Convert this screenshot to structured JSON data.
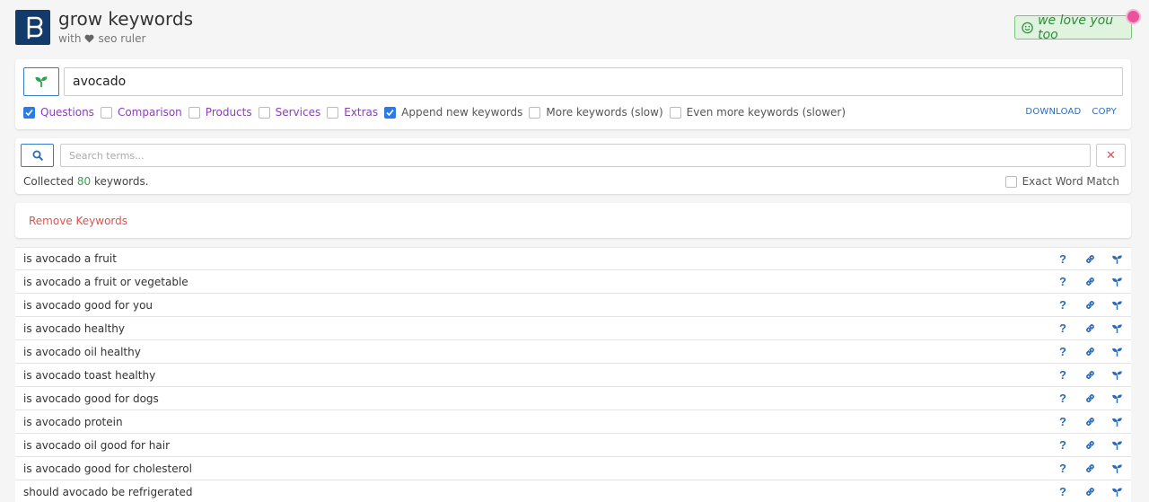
{
  "header": {
    "app_title": "grow keywords",
    "subtitle_prefix": "with",
    "subtitle_suffix": "seo ruler",
    "love_label": "we love you too"
  },
  "grow": {
    "keyword_value": "avocado",
    "options": [
      {
        "label": "Questions",
        "checked": true
      },
      {
        "label": "Comparison",
        "checked": false
      },
      {
        "label": "Products",
        "checked": false
      },
      {
        "label": "Services",
        "checked": false
      },
      {
        "label": "Extras",
        "checked": false
      },
      {
        "label": "Append new keywords",
        "checked": true
      },
      {
        "label": "More keywords (slow)",
        "checked": false
      },
      {
        "label": "Even more keywords (slower)",
        "checked": false
      }
    ],
    "download_label": "DOWNLOAD",
    "copy_label": "COPY"
  },
  "search": {
    "placeholder": "Search terms...",
    "clear_symbol": "✕",
    "collected_prefix": "Collected",
    "collected_count": "80",
    "collected_suffix": "keywords.",
    "exact_match_label": "Exact Word Match"
  },
  "remove": {
    "label": "Remove Keywords"
  },
  "keywords": [
    "is avocado a fruit",
    "is avocado a fruit or vegetable",
    "is avocado good for you",
    "is avocado healthy",
    "is avocado oil healthy",
    "is avocado toast healthy",
    "is avocado good for dogs",
    "is avocado protein",
    "is avocado oil good for hair",
    "is avocado good for cholesterol",
    "should avocado be refrigerated"
  ],
  "row_actions": {
    "question_symbol": "?"
  },
  "colors": {
    "brand_navy": "#123a6a",
    "accent_blue": "#2c6ab5",
    "purple": "#8a3fb5",
    "green": "#2ea44f",
    "red": "#d9534f"
  }
}
